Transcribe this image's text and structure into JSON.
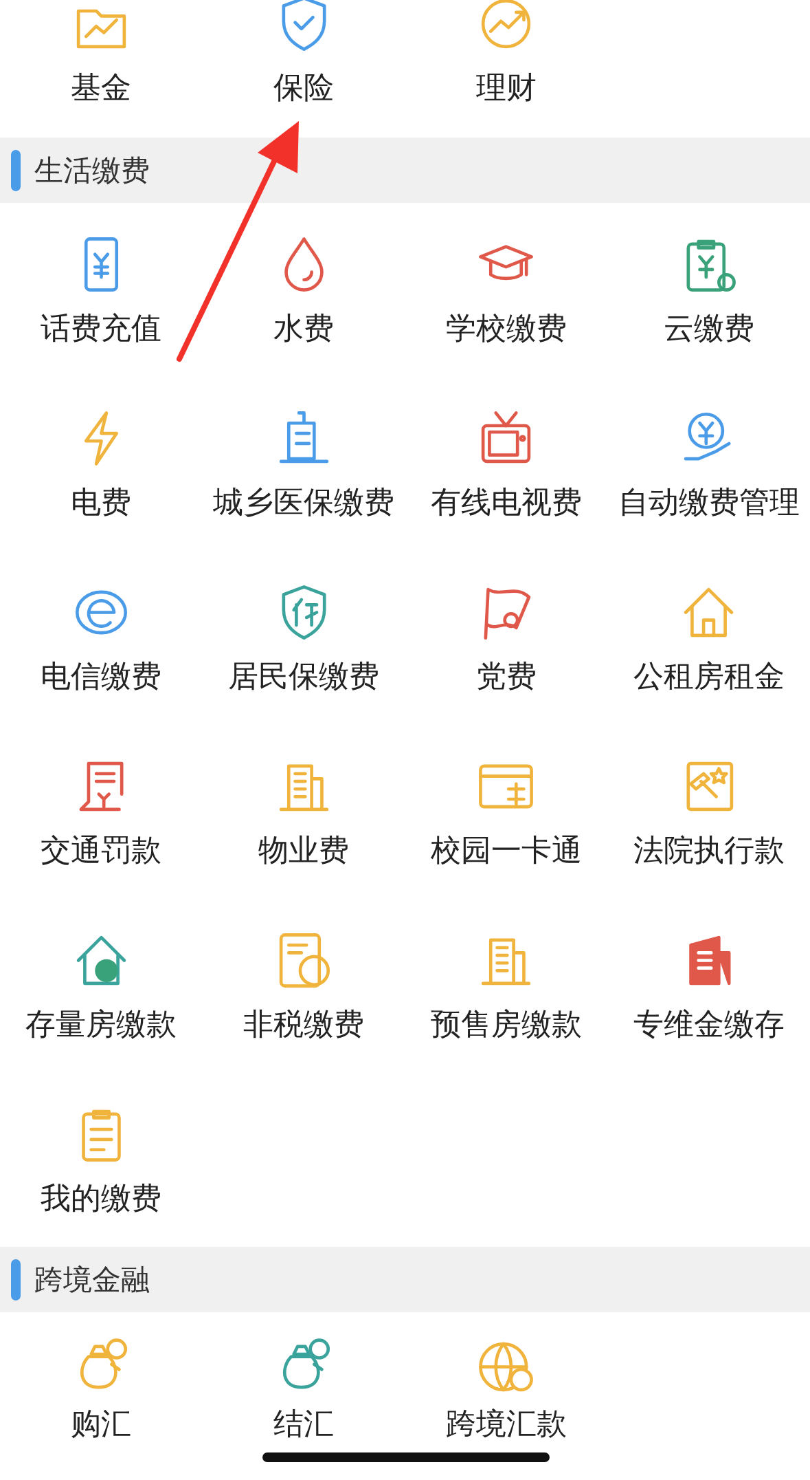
{
  "top_items": [
    {
      "label": "基金"
    },
    {
      "label": "保险"
    },
    {
      "label": "理财"
    }
  ],
  "sections": [
    {
      "title": "生活缴费",
      "items": [
        {
          "label": "话费充值"
        },
        {
          "label": "水费"
        },
        {
          "label": "学校缴费"
        },
        {
          "label": "云缴费"
        },
        {
          "label": "电费"
        },
        {
          "label": "城乡医保缴费"
        },
        {
          "label": "有线电视费"
        },
        {
          "label": "自动缴费管理"
        },
        {
          "label": "电信缴费"
        },
        {
          "label": "居民保缴费"
        },
        {
          "label": "党费"
        },
        {
          "label": "公租房租金"
        },
        {
          "label": "交通罚款"
        },
        {
          "label": "物业费"
        },
        {
          "label": "校园一卡通"
        },
        {
          "label": "法院执行款"
        },
        {
          "label": "存量房缴款"
        },
        {
          "label": "非税缴费"
        },
        {
          "label": "预售房缴款"
        },
        {
          "label": "专维金缴存"
        },
        {
          "label": "我的缴费"
        }
      ]
    },
    {
      "title": "跨境金融",
      "items": [
        {
          "label": "购汇"
        },
        {
          "label": "结汇"
        },
        {
          "label": "跨境汇款"
        }
      ]
    }
  ]
}
